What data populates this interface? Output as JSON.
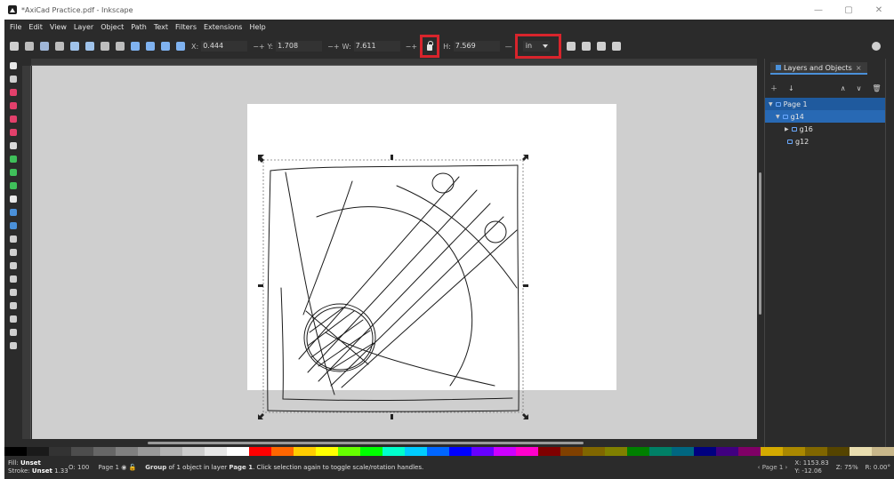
{
  "window": {
    "title": "*AxiCad Practice.pdf - Inkscape",
    "controls": [
      "—",
      "▢",
      "✕"
    ]
  },
  "menu": [
    "File",
    "Edit",
    "View",
    "Layer",
    "Object",
    "Path",
    "Text",
    "Filters",
    "Extensions",
    "Help"
  ],
  "toolbar": {
    "x_label": "X:",
    "x_value": "0.444",
    "y_label": "Y:",
    "y_value": "1.708",
    "w_label": "W:",
    "w_value": "7.611",
    "h_label": "H:",
    "h_value": "7.569",
    "unit": "in",
    "highlight_color": "#d8242c"
  },
  "layers_panel": {
    "tab_label": "Layers and Objects",
    "tab_close": "×",
    "tree": [
      {
        "label": "Page 1",
        "depth": 0,
        "expanded": "▼"
      },
      {
        "label": "g14",
        "depth": 1,
        "expanded": "▼"
      },
      {
        "label": "g16",
        "depth": 2,
        "expanded": "▶"
      },
      {
        "label": "g12",
        "depth": 2,
        "expanded": ""
      }
    ]
  },
  "status": {
    "fill_label": "Fill:",
    "fill_value": "Unset",
    "stroke_label": "Stroke:",
    "stroke_value": "Unset",
    "stroke_width": "1.33",
    "opacity_label": "O:",
    "opacity_value": "100",
    "layer": "Page 1",
    "message_prefix": "Group",
    "message_body": " of 1 object in layer ",
    "message_layer": "Page 1",
    "message_suffix": ". Click selection again to toggle scale/rotation handles.",
    "page_nav": "Page 1",
    "x_label": "X:",
    "x_value": "1153.83",
    "y_label": "Y:",
    "y_value": "-12.06",
    "zoom_label": "Z:",
    "zoom_value": "75%",
    "rotation_label": "R:",
    "rotation_value": "0.00°"
  },
  "colors": {
    "accent": "#1f5a9e",
    "canvas_bg": "#cfcfcf",
    "page_bg": "#ffffff",
    "ui_bg": "#2b2b2b"
  }
}
